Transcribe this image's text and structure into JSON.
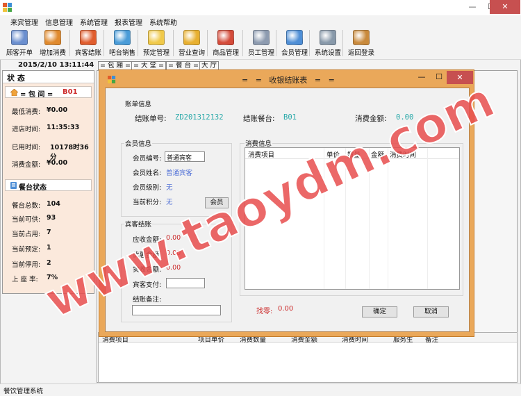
{
  "window": {
    "minimize_glyph": "—",
    "maximize_glyph": "☐",
    "close_glyph": "✕"
  },
  "menu": [
    "来宾管理",
    "信息管理",
    "系统管理",
    "报表管理",
    "系统帮助"
  ],
  "toolbar": [
    {
      "label": "顾客开单",
      "icon": "open-order-icon",
      "color": "#6b8fcf"
    },
    {
      "label": "增加消费",
      "icon": "add-consumption-icon",
      "color": "#e08a2e"
    },
    {
      "label": "宾客结账",
      "icon": "checkout-icon",
      "color": "#e05d2e"
    },
    {
      "label": "吧台销售",
      "icon": "bar-sales-icon",
      "color": "#4a9cd8"
    },
    {
      "label": "预定管理",
      "icon": "reservation-icon",
      "color": "#f0c94a"
    },
    {
      "label": "营业查询",
      "icon": "business-query-icon",
      "color": "#e8b030"
    },
    {
      "label": "商品管理",
      "icon": "product-icon",
      "color": "#d44b3a"
    },
    {
      "label": "员工管理",
      "icon": "staff-icon",
      "color": "#8d9bb0"
    },
    {
      "label": "会员管理",
      "icon": "member-icon",
      "color": "#4f8fd6"
    },
    {
      "label": "系统设置",
      "icon": "settings-icon",
      "color": "#8899aa"
    },
    {
      "label": "返回登录",
      "icon": "exit-icon",
      "color": "#c98a3c"
    }
  ],
  "datetime": "2015/2/10 13:11:44",
  "left_panel": {
    "tab_label": "状 态",
    "room_header_prefix": "= 包  间 =",
    "room_code": "B01",
    "min_consumption_label": "最低消费:",
    "min_consumption_value": "¥0.00",
    "entry_time_label": "进店时间:",
    "entry_time_value": "11:35:33",
    "used_time_label": "已用时间:",
    "used_time_value": "10178时36分",
    "consumption_label": "消费金额:",
    "consumption_value": "¥0.00",
    "table_status_header": "餐台状态",
    "total_label": "餐台总数:",
    "total_value": "104",
    "available_label": "当前可供:",
    "available_value": "93",
    "occupied_label": "当前占用:",
    "occupied_value": "7",
    "reserved_label": "当前预定:",
    "reserved_value": "1",
    "disabled_label": "当前停用:",
    "disabled_value": "2",
    "seat_rate_label": "上 座 率:",
    "seat_rate_value": "7%"
  },
  "tabs": [
    "= 包 厢 =",
    "= 大 堂 =",
    "= 餐 台 =",
    "大 厅"
  ],
  "bottom_grid_headers": [
    "消费项目",
    "项目单价",
    "消费数量",
    "消费金额",
    "消费时间",
    "服务生",
    "备注"
  ],
  "status_bar": "餐饮管理系统",
  "dialog": {
    "title": "=   =   收银结账表   =   =",
    "bill_group": "账单信息",
    "bill_no_label": "结账单号:",
    "bill_no_value": "ZD201312132",
    "table_label": "结账餐台:",
    "table_value": "B01",
    "amount_label": "消费金额:",
    "amount_value": "0.00",
    "member_group": "会员信息",
    "member_no_label": "会员编号:",
    "member_no_value": "普通宾客",
    "member_name_label": "会员姓名:",
    "member_name_value": "普通宾客",
    "member_level_label": "会员级别:",
    "member_level_value": "无",
    "member_points_label": "当前积分:",
    "member_points_value": "无",
    "member_button": "会员",
    "checkout_group": "宾客结账",
    "receivable_label": "应收金额:",
    "receivable_value": "0.00",
    "discount_label": "优惠金额:",
    "discount_value": "0.00",
    "actual_label": "实收金额:",
    "actual_value": "0.00",
    "paid_label": "宾客支付:",
    "paid_value": "",
    "note_label": "结账备注:",
    "note_value": "",
    "consumption_group": "消费信息",
    "grid_headers": [
      "消费项目",
      "单价",
      "数量",
      "金额",
      "消费时间"
    ],
    "change_label": "找零:",
    "change_value": "0.00",
    "confirm_button": "确定",
    "cancel_button": "取消"
  },
  "watermark": "www.taoydm.com",
  "colors": {
    "dialog_frame": "#eaa85a",
    "accent_teal": "#29a9a9",
    "red_value": "#cc2b2b",
    "panel_bg": "#fbe9dc",
    "watermark": "#e84e4e"
  }
}
